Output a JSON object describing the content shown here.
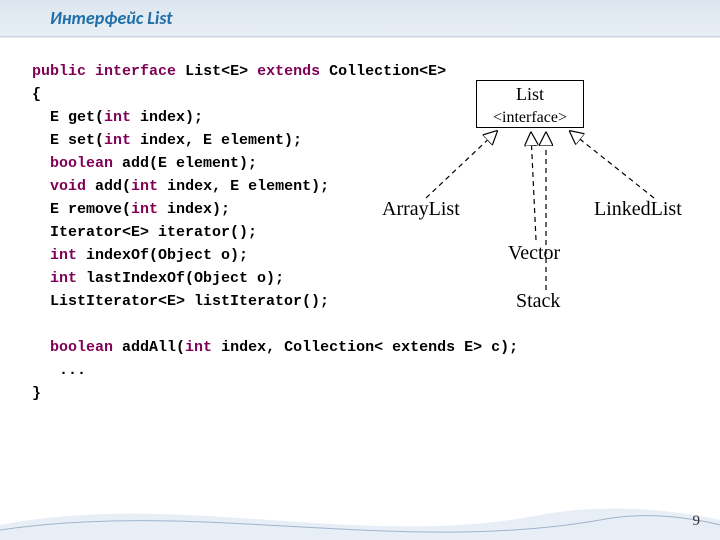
{
  "title": "Интерфейс List",
  "code": {
    "kw_public": "public",
    "kw_interface": "interface",
    "name": "List<E>",
    "kw_extends": "extends",
    "super": "Collection<E>",
    "brace_open": "{",
    "m1_a": "  E get(",
    "kw_int": "int",
    "m1_b": " index);",
    "m2_a": "  E set(",
    "m2_b": " index, E element);",
    "kw_boolean": "boolean",
    "m3_a": " add(E element);",
    "kw_void": "void",
    "m4_a": " add(",
    "m4_b": " index, E element);",
    "m5_a": "  E remove(",
    "m5_b": " index);",
    "m6": "  Iterator<E> iterator();",
    "m7_a": " indexOf(Object o);",
    "m8_a": " lastIndexOf(Object o);",
    "m9": "  ListIterator<E> listIterator();",
    "blank": " ",
    "m10_a": " addAll(",
    "m10_b": " index, Collection< extends E> c);",
    "dots": "   ...",
    "brace_close": "}"
  },
  "diagram": {
    "box_line1": "List",
    "box_line2": "<interface>",
    "l1": "ArrayList",
    "l2": "LinkedList",
    "l3": "Vector",
    "l4": "Stack"
  },
  "page_number": "9"
}
